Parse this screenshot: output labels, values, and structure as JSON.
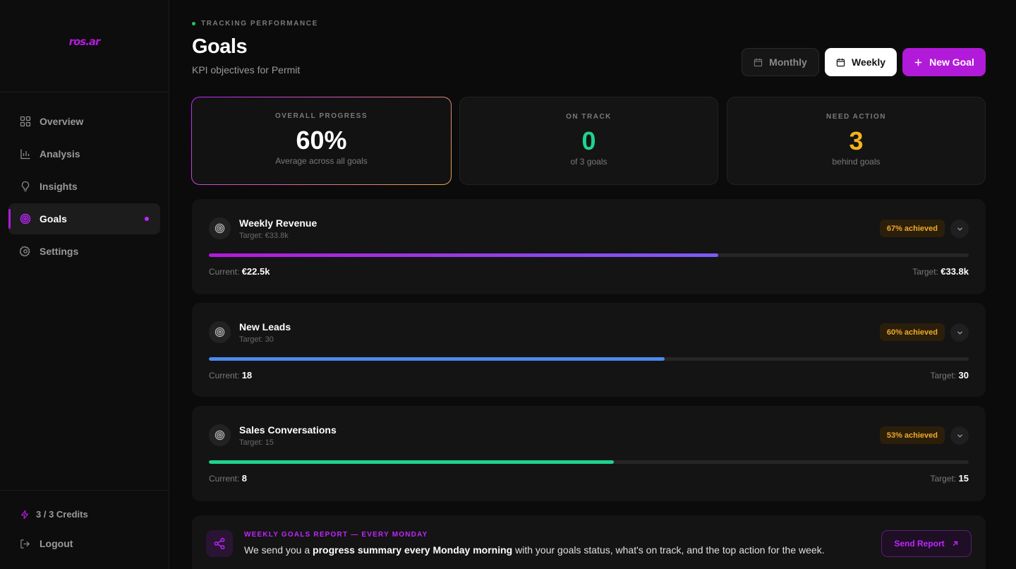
{
  "brand": {
    "logo_text": "ros.ar",
    "accent": "#b21ad9"
  },
  "sidebar": {
    "items": [
      {
        "label": "Overview",
        "icon": "grid-icon"
      },
      {
        "label": "Analysis",
        "icon": "bar-chart-icon"
      },
      {
        "label": "Insights",
        "icon": "lightbulb-icon"
      },
      {
        "label": "Goals",
        "icon": "target-icon",
        "active": true
      },
      {
        "label": "Settings",
        "icon": "gear-icon"
      }
    ],
    "credits": "3 / 3 Credits",
    "logout": "Logout"
  },
  "header": {
    "eyebrow": "TRACKING PERFORMANCE",
    "title": "Goals",
    "subtitle": "KPI objectives for Permit",
    "buttons": {
      "monthly": "Monthly",
      "weekly": "Weekly",
      "new_goal": "New Goal"
    },
    "selected_period": "Weekly"
  },
  "stats": [
    {
      "label": "OVERALL PROGRESS",
      "value": "60%",
      "desc": "Average across all goals",
      "color": "#ffffff"
    },
    {
      "label": "ON TRACK",
      "value": "0",
      "desc": "of 3 goals",
      "color": "#1fd38e"
    },
    {
      "label": "NEED ACTION",
      "value": "3",
      "desc": "behind goals",
      "color": "#f5b417"
    }
  ],
  "goals": [
    {
      "name": "Weekly Revenue",
      "target_sub": "Target: €33.8k",
      "badge": "67% achieved",
      "progress": 0.67,
      "color": "linear-gradient(90deg, #b21ad9, #7b5cf5)",
      "current_label": "Current:",
      "current": "€22.5k",
      "target_label": "Target:",
      "target": "€33.8k"
    },
    {
      "name": "New Leads",
      "target_sub": "Target: 30",
      "badge": "60% achieved",
      "progress": 0.6,
      "color": "#4a8af0",
      "current_label": "Current:",
      "current": "18",
      "target_label": "Target:",
      "target": "30"
    },
    {
      "name": "Sales Conversations",
      "target_sub": "Target: 15",
      "badge": "53% achieved",
      "progress": 0.533,
      "color": "#1fd38e",
      "current_label": "Current:",
      "current": "8",
      "target_label": "Target:",
      "target": "15"
    }
  ],
  "report": {
    "kicker": "WEEKLY GOALS REPORT — EVERY MONDAY",
    "text_pre": "We send you a ",
    "text_bold": "progress summary every Monday morning",
    "text_post": " with your goals status, what's on track, and the top action for the week.",
    "button": "Send Report"
  }
}
